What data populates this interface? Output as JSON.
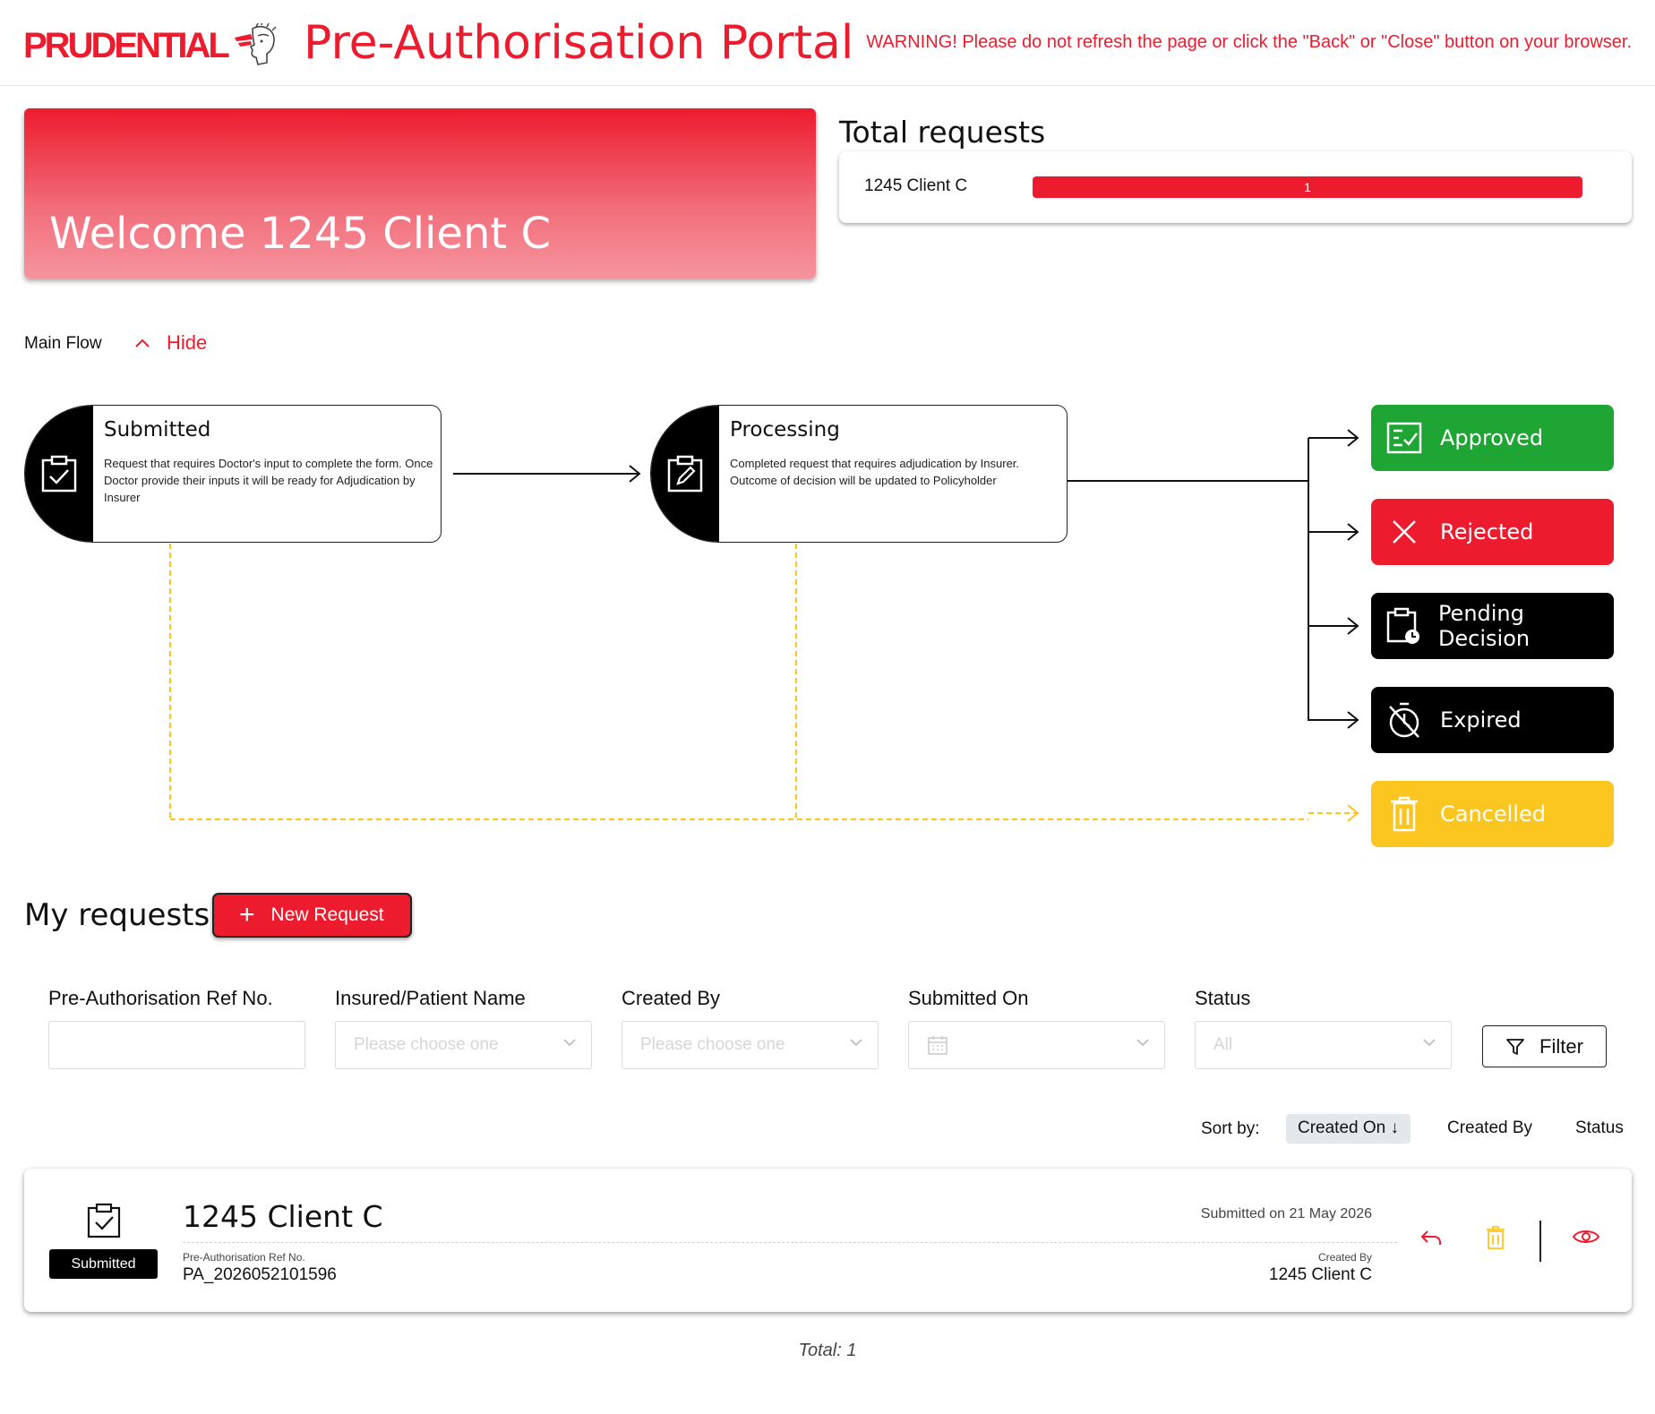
{
  "header": {
    "logo_text": "PRUDENTIAL",
    "title": "Pre-Authorisation Portal",
    "warning": "WARNING! Please do not refresh the page or click the \"Back\" or \"Close\" button on your browser.",
    "brand_color": "#ed1b2e"
  },
  "welcome": {
    "text": "Welcome 1245 Client C"
  },
  "total_requests": {
    "title": "Total requests",
    "rows": [
      {
        "label": "1245 Client C",
        "value": "1",
        "fraction": 1.0
      }
    ]
  },
  "flow": {
    "label": "Main Flow",
    "toggle_label": "Hide",
    "stages": [
      {
        "title": "Submitted",
        "description": "Request that requires Doctor's input to complete the form. Once Doctor provide their inputs it will be ready for Adjudication by Insurer",
        "icon": "clipboard-check-icon"
      },
      {
        "title": "Processing",
        "description": "Completed request that requires adjudication by Insurer. Outcome of decision will be updated to Policyholder",
        "icon": "clipboard-edit-icon"
      }
    ],
    "outcomes": [
      {
        "label": "Approved",
        "color": "#1fa533",
        "icon": "checklist-icon"
      },
      {
        "label": "Rejected",
        "color": "#ed1b2e",
        "icon": "close-icon"
      },
      {
        "label": "Pending Decision",
        "color": "#000000",
        "icon": "clipboard-clock-icon"
      },
      {
        "label": "Expired",
        "color": "#000000",
        "icon": "timer-off-icon"
      },
      {
        "label": "Cancelled",
        "color": "#fcc621",
        "icon": "trash-icon"
      }
    ]
  },
  "my_requests": {
    "title": "My requests",
    "new_request_label": "New Request",
    "filters": [
      {
        "label": "Pre-Authorisation Ref No.",
        "placeholder": ""
      },
      {
        "label": "Insured/Patient Name",
        "placeholder": "Please choose one"
      },
      {
        "label": "Created By",
        "placeholder": "Please choose one"
      },
      {
        "label": "Submitted On",
        "placeholder": ""
      },
      {
        "label": "Status",
        "placeholder": "All"
      }
    ],
    "filter_button": "Filter",
    "sort": {
      "label": "Sort by:",
      "options": [
        "Created On ↓",
        "Created By",
        "Status"
      ],
      "active": "Created On ↓"
    },
    "items": [
      {
        "status": "Submitted",
        "name": "1245 Client C",
        "ref_label": "Pre-Authorisation Ref No.",
        "ref": "PA_2026052101596",
        "submitted": "Submitted on 21 May 2026",
        "created_label": "Created By",
        "created_by": "1245 Client C"
      }
    ],
    "total_label": "Total:",
    "total": "1"
  }
}
